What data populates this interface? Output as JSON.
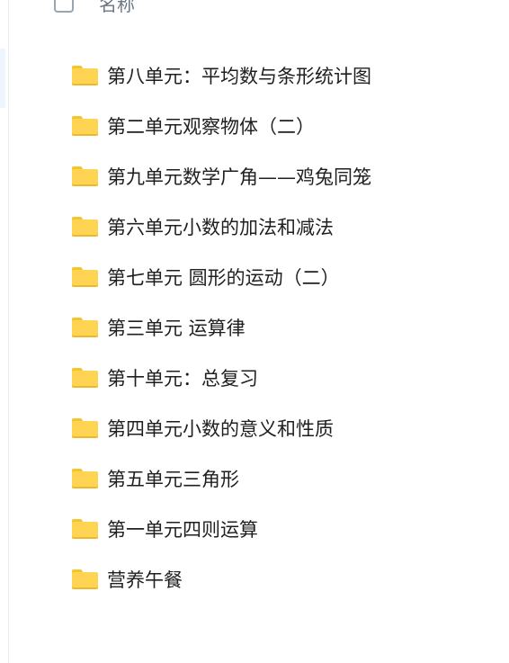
{
  "header": {
    "column_title": "名称"
  },
  "folders": [
    {
      "name": "第八单元：平均数与条形统计图",
      "icon": "folder-icon"
    },
    {
      "name": "第二单元观察物体（二）",
      "icon": "folder-icon"
    },
    {
      "name": "第九单元数学广角——鸡兔同笼",
      "icon": "folder-icon"
    },
    {
      "name": "第六单元小数的加法和减法",
      "icon": "folder-icon"
    },
    {
      "name": "第七单元 圆形的运动（二）",
      "icon": "folder-icon"
    },
    {
      "name": "第三单元 运算律",
      "icon": "folder-icon"
    },
    {
      "name": "第十单元：总复习",
      "icon": "folder-icon"
    },
    {
      "name": "第四单元小数的意义和性质",
      "icon": "folder-icon"
    },
    {
      "name": "第五单元三角形",
      "icon": "folder-icon"
    },
    {
      "name": "第一单元四则运算",
      "icon": "folder-icon"
    },
    {
      "name": "营养午餐",
      "icon": "folder-icon"
    }
  ],
  "colors": {
    "folder": "#ffd452",
    "folder_tab": "#f4c430",
    "text": "#1f1f1f",
    "header_text": "#6b7685"
  }
}
